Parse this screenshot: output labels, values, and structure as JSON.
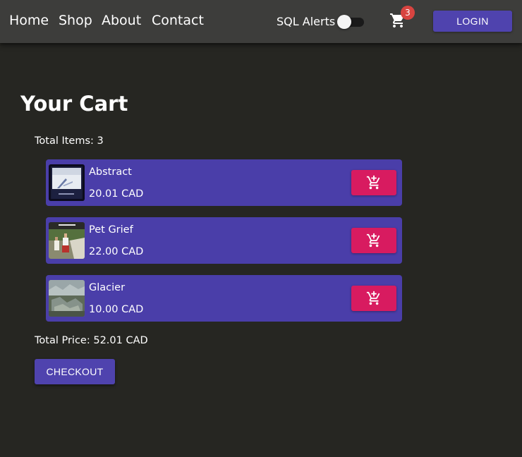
{
  "nav": {
    "links": [
      "Home",
      "Shop",
      "About",
      "Contact"
    ],
    "sql_alerts_label": "SQL Alerts",
    "sql_alerts_on": false,
    "cart_icon": "shopping-cart-icon",
    "cart_count": "3",
    "login_label": "LOGIN"
  },
  "cart": {
    "title": "Your Cart",
    "total_items_label": "Total Items: 3",
    "items": [
      {
        "title": "Abstract",
        "price": "20.01 CAD",
        "icon": "add-shopping-cart-icon"
      },
      {
        "title": "Pet Grief",
        "price": "22.00 CAD",
        "icon": "add-shopping-cart-icon"
      },
      {
        "title": "Glacier",
        "price": "10.00 CAD",
        "icon": "add-shopping-cart-icon"
      }
    ],
    "total_price_label": "Total Price: 52.01 CAD",
    "checkout_label": "CHECKOUT"
  },
  "colors": {
    "background": "#262622",
    "appbar": "#3d3d3b",
    "primary": "#4f43ae",
    "item_card": "#4a3ea9",
    "accent": "#d81b60",
    "badge": "#d84440"
  }
}
